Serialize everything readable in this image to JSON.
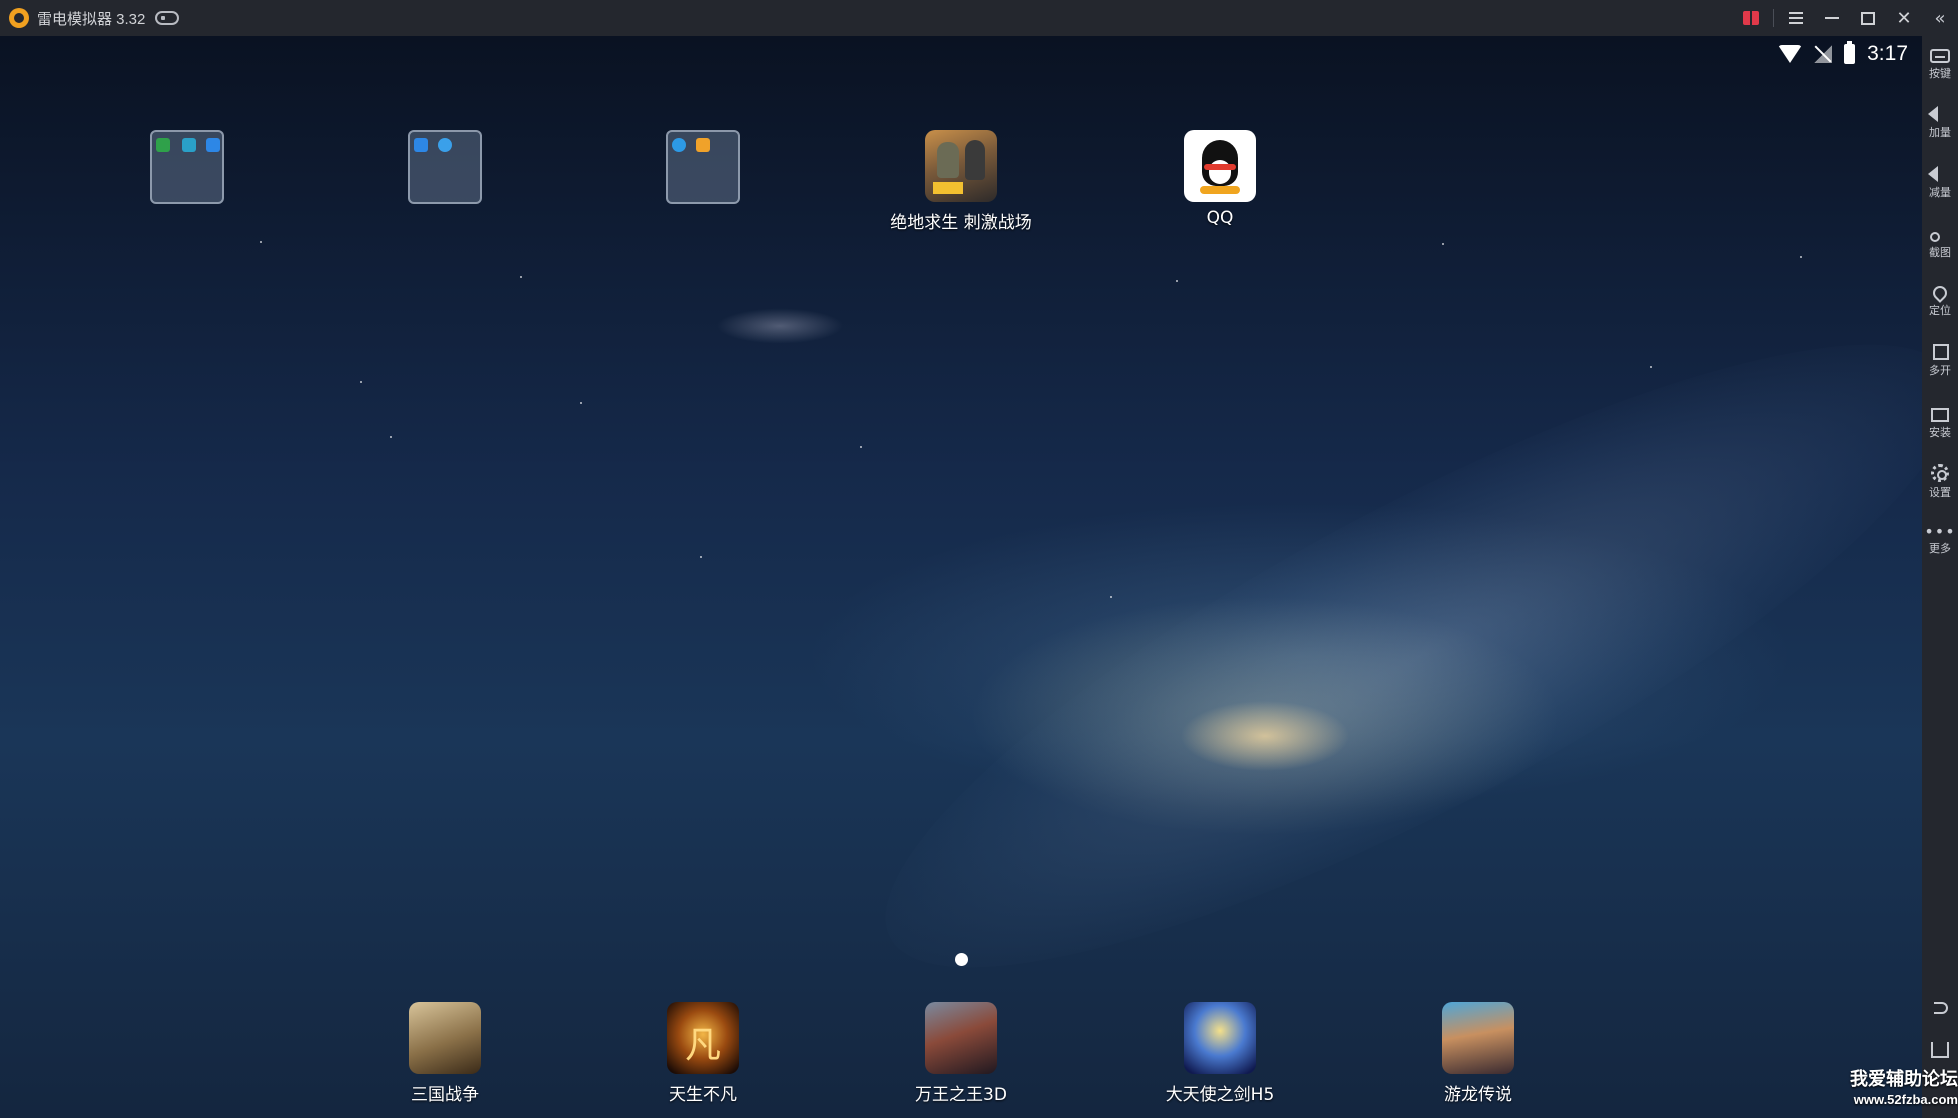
{
  "window": {
    "title": "雷电模拟器 3.32",
    "controls": {
      "gift": "gift-icon",
      "menu": "menu-icon",
      "minimize": "minimize-icon",
      "maximize": "maximize-icon",
      "close": "close-icon"
    }
  },
  "statusbar": {
    "time": "3:17",
    "icons": [
      "wifi-icon",
      "no-signal-icon",
      "battery-charging-icon"
    ]
  },
  "home": {
    "folders": [
      {
        "name": "folder-system",
        "icons": [
          "settings-icon",
          "refresh-icon",
          "file-folder-icon"
        ]
      },
      {
        "name": "folder-contacts",
        "icons": [
          "contacts-icon",
          "browser-icon"
        ]
      },
      {
        "name": "folder-downloads",
        "icons": [
          "download-icon",
          "gallery-icon"
        ]
      }
    ],
    "top_apps": [
      {
        "label": "绝地求生 刺激战场"
      },
      {
        "label": "QQ"
      }
    ],
    "dock_apps": [
      {
        "label": "三国战争"
      },
      {
        "label": "天生不凡",
        "glyph": "凡"
      },
      {
        "label": "万王之王3D"
      },
      {
        "label": "大天使之剑H5"
      },
      {
        "label": "游龙传说"
      }
    ],
    "page_indicator": {
      "current": 1,
      "total": 1
    }
  },
  "sidebar": {
    "collapse": "«",
    "items": [
      {
        "label": "按键",
        "icon": "keyboard-icon"
      },
      {
        "label": "加量",
        "icon": "volume-up-icon"
      },
      {
        "label": "减量",
        "icon": "volume-down-icon"
      },
      {
        "label": "截图",
        "icon": "scissors-icon"
      },
      {
        "label": "定位",
        "icon": "location-pin-icon"
      },
      {
        "label": "多开",
        "icon": "multi-instance-icon"
      },
      {
        "label": "安装",
        "icon": "apk-install-icon"
      },
      {
        "label": "设置",
        "icon": "gear-icon"
      },
      {
        "label": "更多",
        "icon": "more-icon",
        "glyph": "•••"
      }
    ],
    "bottom": [
      {
        "icon": "back-icon"
      },
      {
        "icon": "home-icon"
      }
    ]
  },
  "watermark": {
    "line1": "我爱辅助论坛",
    "line2": "www.52fzba.com"
  }
}
